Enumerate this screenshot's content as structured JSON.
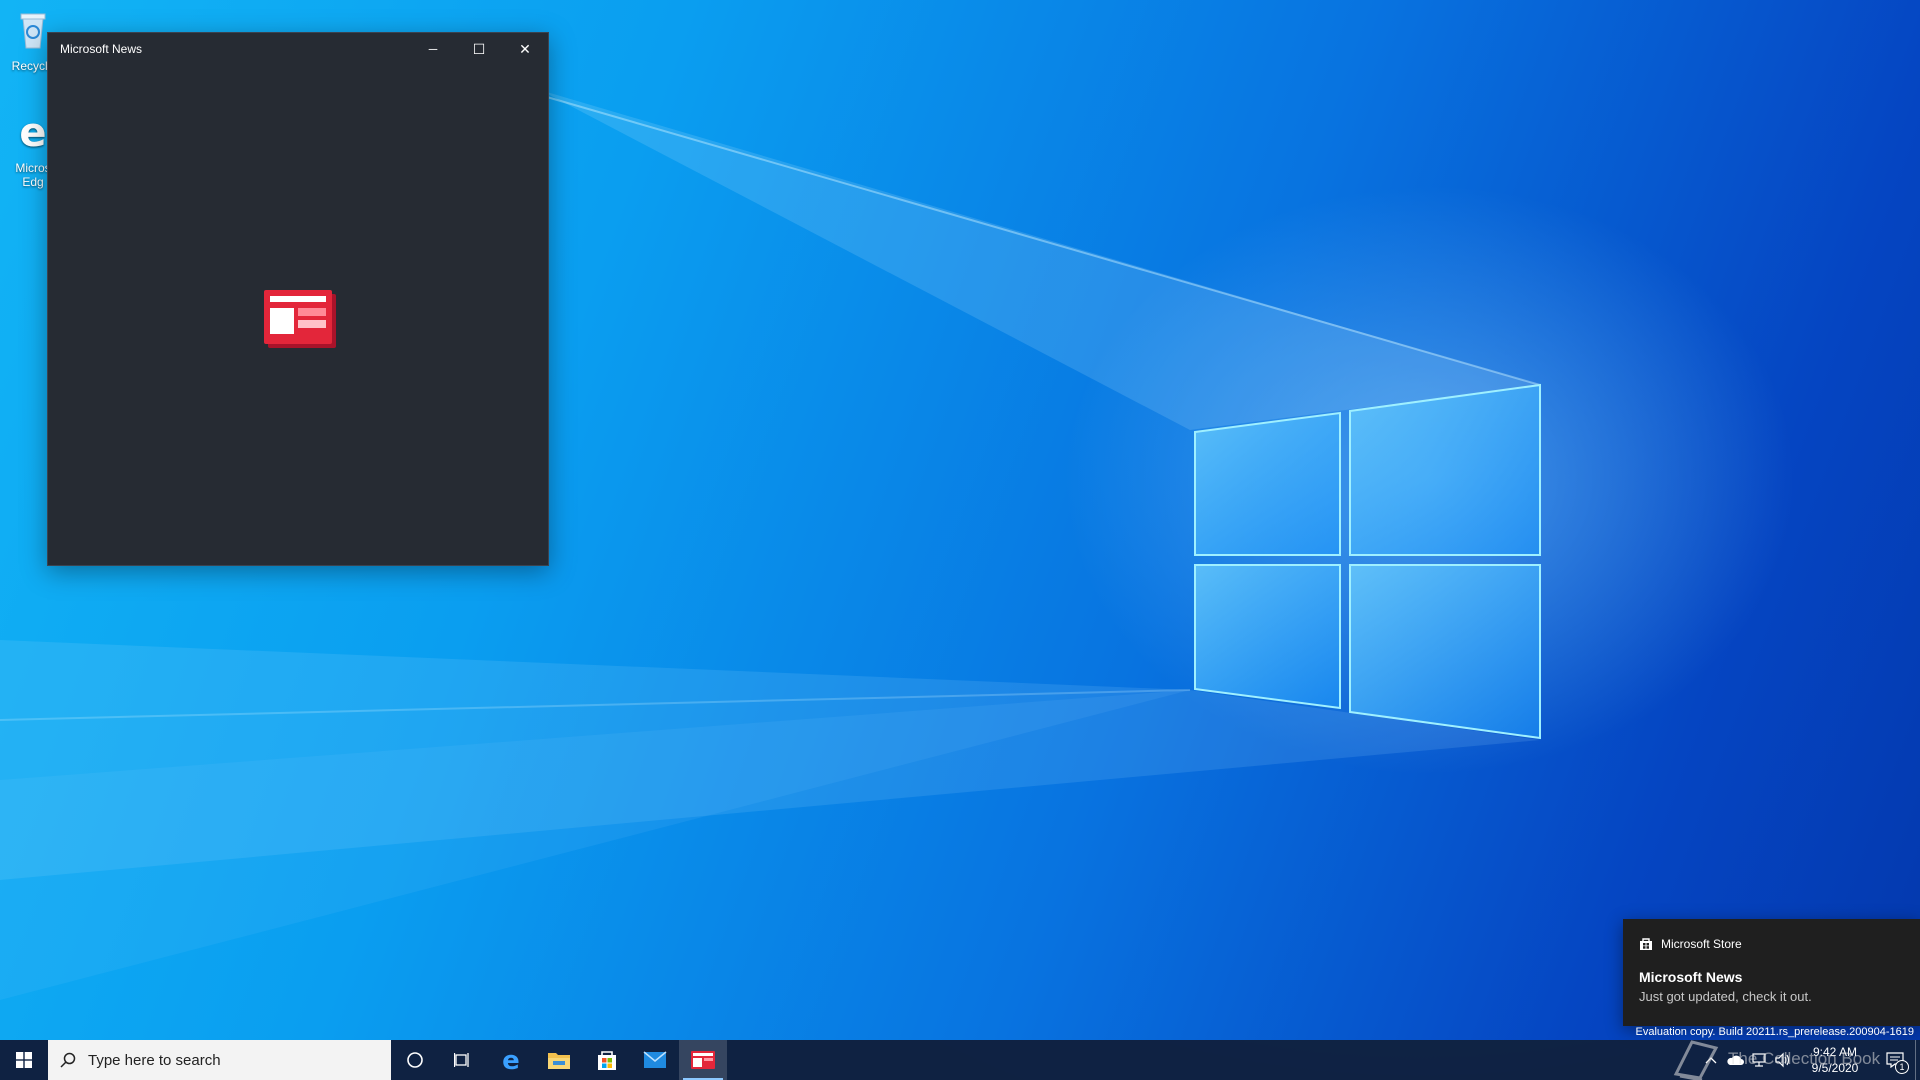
{
  "desktop": {
    "icons": [
      {
        "label": "Recycle"
      },
      {
        "label": "Micros\nEdg"
      }
    ]
  },
  "window": {
    "title": "Microsoft News",
    "minimize_glyph": "─",
    "maximize_glyph": "☐",
    "close_glyph": "✕"
  },
  "toast": {
    "app": "Microsoft Store",
    "title": "Microsoft News",
    "body": "Just got updated, check it out."
  },
  "eval_text": "Evaluation copy. Build 20211.rs_prerelease.200904-1619",
  "taskbar": {
    "search_placeholder": "Type here to search",
    "apps": [
      "cortana",
      "task-view",
      "edge",
      "file-explorer",
      "store",
      "mail",
      "news"
    ],
    "clock_time": "9:42 AM",
    "clock_date": "9/5/2020",
    "notification_count": "1"
  },
  "watermark": "The Collection Book",
  "colors": {
    "accent": "#0078d7",
    "news_red": "#e3263a",
    "window_bg": "#262b33",
    "toast_bg": "#1f1f1f"
  }
}
